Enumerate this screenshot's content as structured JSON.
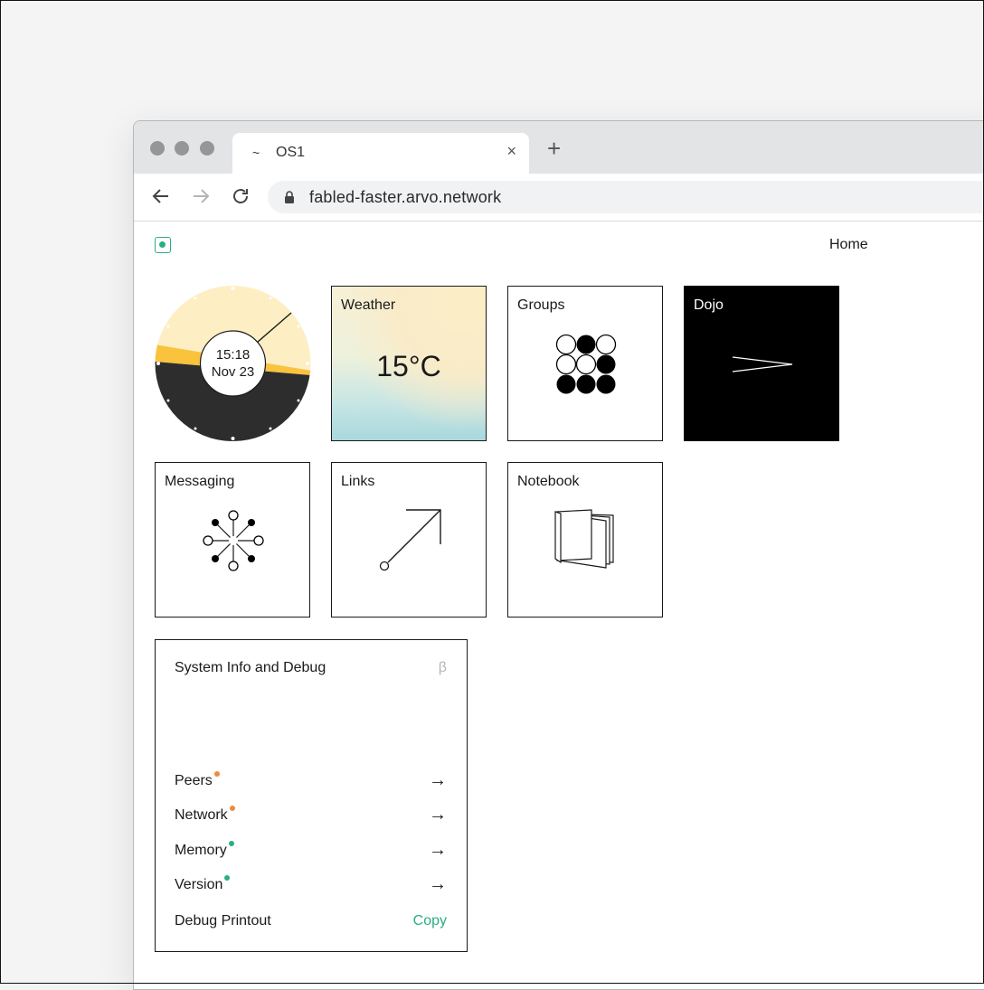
{
  "tab": {
    "favicon": "~",
    "title": "OS1",
    "close_icon": "×",
    "new_tab_icon": "+"
  },
  "address": {
    "url": "fabled-faster.arvo.network"
  },
  "header": {
    "home_label": "Home"
  },
  "clock": {
    "time": "15:18",
    "date": "Nov 23"
  },
  "tiles": {
    "weather": {
      "label": "Weather",
      "temperature": "15°C"
    },
    "groups": {
      "label": "Groups"
    },
    "dojo": {
      "label": "Dojo"
    },
    "messaging": {
      "label": "Messaging"
    },
    "links": {
      "label": "Links"
    },
    "notebook": {
      "label": "Notebook"
    }
  },
  "system_info": {
    "title": "System Info and Debug",
    "beta_badge": "β",
    "rows": [
      {
        "label": "Peers",
        "status_color": "#f08a3c",
        "action": "→"
      },
      {
        "label": "Network",
        "status_color": "#f08a3c",
        "action": "→"
      },
      {
        "label": "Memory",
        "status_color": "#2bae7e",
        "action": "→"
      },
      {
        "label": "Version",
        "status_color": "#2bae7e",
        "action": "→"
      }
    ],
    "debug": {
      "label": "Debug Printout",
      "action": "Copy"
    }
  },
  "colors": {
    "accent": "#2bae7e",
    "warning": "#f08a3c",
    "clock_day": "#fdefc3",
    "clock_sun": "#f9c33e",
    "clock_night": "#2d2d2d"
  }
}
